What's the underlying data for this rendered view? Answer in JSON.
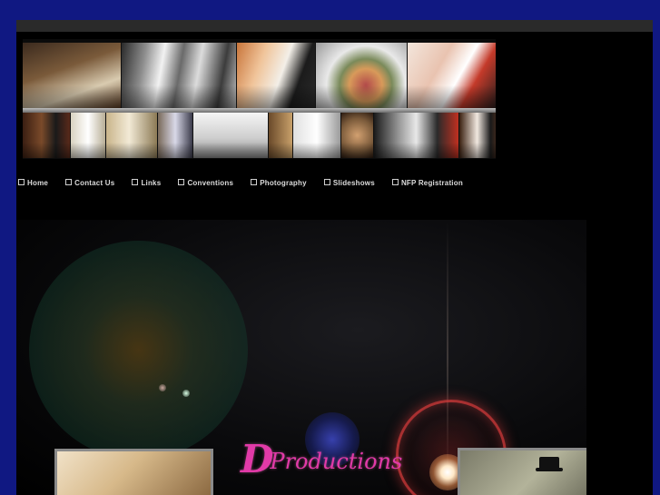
{
  "nav": {
    "items": [
      {
        "label": "Home"
      },
      {
        "label": "Contact Us"
      },
      {
        "label": "Links"
      },
      {
        "label": "Conventions"
      },
      {
        "label": "Photography"
      },
      {
        "label": "Slideshows"
      },
      {
        "label": "NFP Registration"
      }
    ]
  },
  "logo": {
    "initial": "D",
    "text": "Productions"
  },
  "colors": {
    "outer_background": "#101882",
    "page_background": "#000000",
    "top_bar": "#2a2a2a",
    "nav_text": "#dcdcdc",
    "logo_text": "#e23aa8"
  },
  "banner": {
    "top_row_photos": [
      "church-altar-photo",
      "flower-girls-photo",
      "couple-kiss-photo",
      "bouquet-photo",
      "ring-hands-photo"
    ],
    "bottom_row_photos": [
      "couple-photo",
      "bride-veil-photo",
      "bride-dress-photo",
      "church-aisle-photo",
      "couple-walking-photo",
      "bride-profile-photo",
      "flowers-photo",
      "couple-kiss-bw-photo",
      "bride-groom-photo"
    ]
  }
}
